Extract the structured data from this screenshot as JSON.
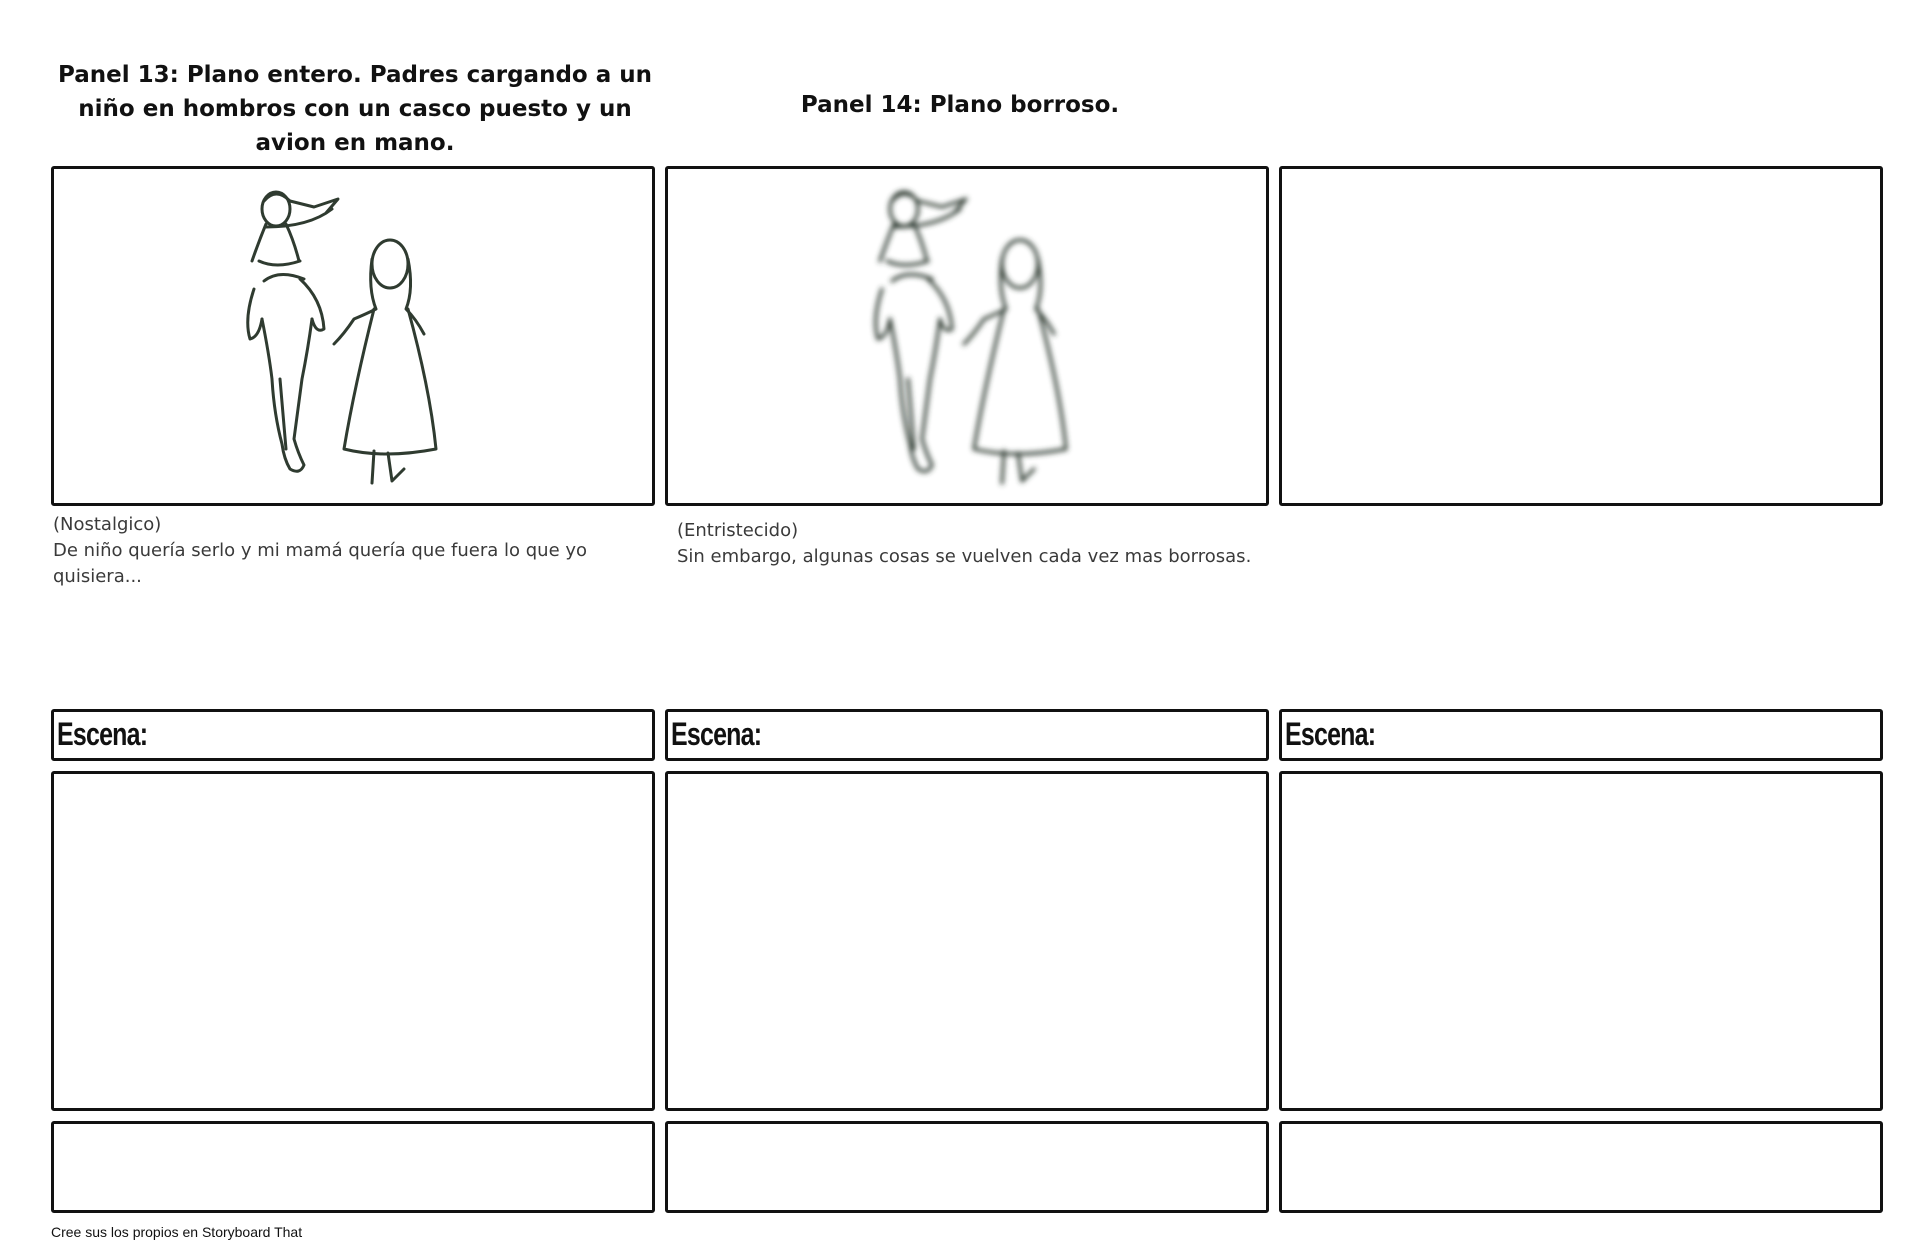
{
  "panels": [
    {
      "title": "Panel 13: Plano entero. Padres cargando a un niño en hombros con un casco puesto y un avion en mano.",
      "caption_emotion": "(Nostalgico)",
      "caption_text": "De niño quería serlo y mi mamá quería que fuera lo que yo quisiera...",
      "image": "family-silhouette-sketch"
    },
    {
      "title": "Panel 14: Plano borroso.",
      "caption_emotion": "(Entristecido)",
      "caption_text": "Sin embargo, algunas cosas se vuelven cada vez mas borrosas.",
      "image": "family-silhouette-sketch-blurred"
    },
    {
      "title": "",
      "caption_emotion": "",
      "caption_text": "",
      "image": ""
    }
  ],
  "scenes": [
    {
      "label": "Escena:"
    },
    {
      "label": "Escena:"
    },
    {
      "label": "Escena:"
    }
  ],
  "footer": "Cree sus los propios en Storyboard That",
  "colors": {
    "border": "#111111",
    "sketch": "#2f3b30",
    "caption": "#3a3a3a"
  }
}
